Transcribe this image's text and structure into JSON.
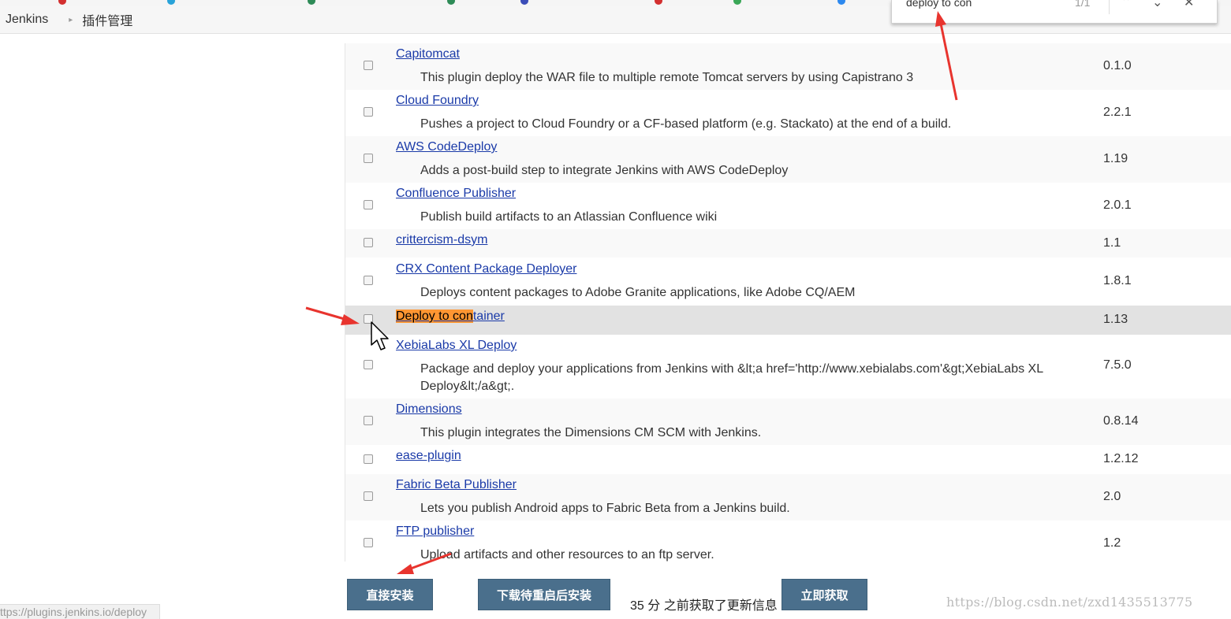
{
  "breadcrumb": {
    "items": [
      "Jenkins",
      "插件管理"
    ],
    "separator": "▸"
  },
  "find_bar": {
    "query": "deploy to con",
    "count": "1/1",
    "icons": [
      "chevron-up-icon",
      "chevron-down-icon",
      "close-icon"
    ]
  },
  "plugins": [
    {
      "name": "Capitomcat",
      "description": "This plugin deploy the WAR file to multiple remote Tomcat servers by using Capistrano 3",
      "version": "0.1.0"
    },
    {
      "name": "Cloud Foundry",
      "description": "Pushes a project to Cloud Foundry or a CF-based platform (e.g. Stackato) at the end of a build.",
      "version": "2.2.1"
    },
    {
      "name": "AWS CodeDeploy",
      "description": "Adds a post-build step to integrate Jenkins with AWS CodeDeploy",
      "version": "1.19"
    },
    {
      "name": "Confluence Publisher",
      "description": "Publish build artifacts to an Atlassian Confluence wiki",
      "version": "2.0.1"
    },
    {
      "name": "crittercism-dsym",
      "description": "",
      "version": "1.1"
    },
    {
      "name": "CRX Content Package Deployer",
      "description": "Deploys content packages to Adobe Granite applications, like Adobe CQ/AEM",
      "version": "1.8.1"
    },
    {
      "name": "Deploy to container",
      "name_match": "Deploy to con",
      "name_rest": "tainer",
      "description": "",
      "version": "1.13",
      "highlighted": true
    },
    {
      "name": "XebiaLabs XL Deploy",
      "description": "Package and deploy your applications from Jenkins with &lt;a href='http://www.xebialabs.com'&gt;XebiaLabs XL Deploy&lt;/a&gt;.",
      "version": "7.5.0"
    },
    {
      "name": "Dimensions",
      "description": "This plugin integrates the Dimensions CM SCM with Jenkins.",
      "version": "0.8.14"
    },
    {
      "name": "ease-plugin",
      "description": "",
      "version": "1.2.12"
    },
    {
      "name": "Fabric Beta Publisher",
      "description": "Lets you publish Android apps to Fabric Beta from a Jenkins build.",
      "version": "2.0"
    },
    {
      "name": "FTP publisher",
      "description": "Upload artifacts and other resources to an ftp server.",
      "version": "1.2"
    }
  ],
  "actions": {
    "install_now": "直接安装",
    "download_restart": "下载待重启后安装",
    "updated_info": "35 分 之前获取了更新信息",
    "check_now": "立即获取"
  },
  "status_url": "ttps://plugins.jenkins.io/deploy",
  "watermark": "https://blog.csdn.net/zxd1435513775",
  "colors": {
    "link": "#1a3aa8",
    "find_match": "#ff9632",
    "button": "#4a6f8c",
    "annotation_arrow": "#e8342e"
  }
}
